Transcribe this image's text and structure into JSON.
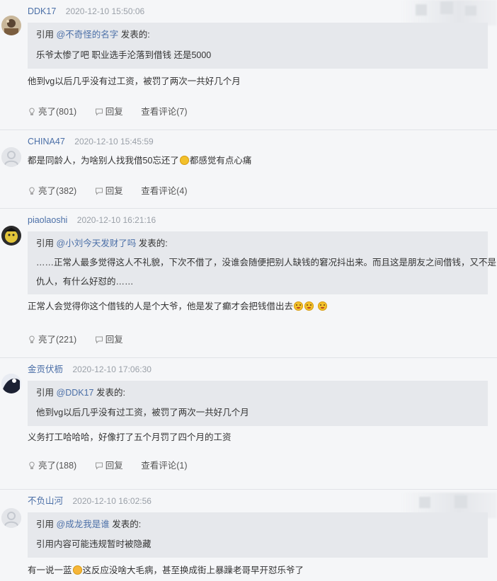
{
  "labels": {
    "quote_prefix": "引用",
    "quote_suffix": "发表的:",
    "like_label": "亮了",
    "reply_label": "回复",
    "view_comments_label": "查看评论"
  },
  "comments": [
    {
      "username": "DDK17",
      "timestamp": "2020-12-10 15:50:06",
      "quote_user": "@不奇怪的名字",
      "quote_text": "乐爷太惨了吧 职业选手沦落到借钱 还是5000",
      "body": "他到vg以后几乎没有过工资，被罚了两次一共好几个月",
      "likes": "(801)",
      "view_count": "(7)"
    },
    {
      "username": "CHINA47",
      "timestamp": "2020-12-10 15:45:59",
      "body_part1": "都是同龄人，为啥别人找我借50忘还了",
      "body_part2": "都感觉有点心痛",
      "likes": "(382)",
      "view_count": "(4)"
    },
    {
      "username": "piaolaoshi",
      "timestamp": "2020-12-10 16:21:16",
      "quote_user": "@小刘今天发财了吗",
      "quote_text_line1": "……正常人最多觉得这人不礼貌，下次不借了，没谁会随便把别人缺钱的窘况抖出来。而且这是朋友之间借钱，又不是",
      "quote_text_line2": "仇人，有什么好怼的……",
      "body": "正常人会觉得你这个借钱的人是个大爷，他是发了癫才会把钱借出去",
      "likes": "(221)"
    },
    {
      "username": "金贡伏枥",
      "timestamp": "2020-12-10 17:06:30",
      "quote_user": "@DDK17",
      "quote_text": "他到vg以后几乎没有过工资，被罚了两次一共好几个月",
      "body": "义务打工哈哈哈，好像打了五个月罚了四个月的工资",
      "likes": "(188)",
      "view_count": "(1)"
    },
    {
      "username": "不负山河",
      "timestamp": "2020-12-10 16:02:56",
      "quote_user": "@成龙我是谁",
      "quote_text": "引用内容可能违规暂时被隐藏",
      "body_part1": "有一说一蓝",
      "body_part2": "这反应没啥大毛病，甚至换成街上暴躁老哥早开怼乐爷了"
    }
  ]
}
